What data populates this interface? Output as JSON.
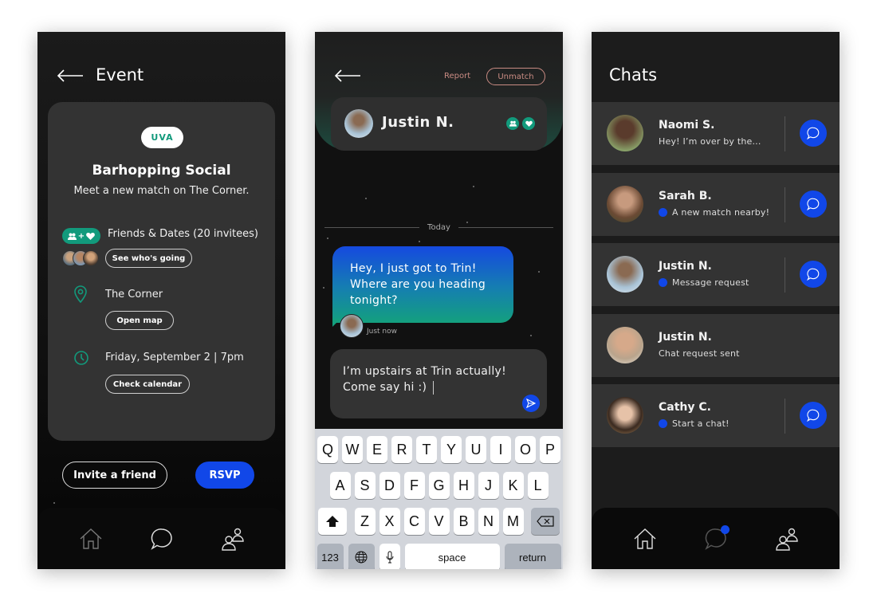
{
  "colors": {
    "accent_blue": "#1147e8",
    "accent_green": "#129a7c",
    "report_red": "#c98b83",
    "card_gray": "#333333",
    "screen_bg": "#1c1c1c"
  },
  "event_screen": {
    "header": {
      "back_icon": "arrow-left-icon",
      "title": "Event"
    },
    "card": {
      "school_tag": "UVA",
      "event_name": "Barhopping Social",
      "event_subtitle": "Meet a new match on The Corner.",
      "audience": {
        "badge_icons": [
          "group-icon",
          "plus",
          "heart-icon"
        ],
        "badge_plus": "+",
        "label": "Friends & Dates (20 invitees)",
        "avatar_count": 3,
        "button": "See who's going"
      },
      "location": {
        "icon": "map-pin-icon",
        "label": "The Corner",
        "button": "Open map"
      },
      "time": {
        "icon": "clock-icon",
        "label": "Friday, September 2 | 7pm",
        "button": "Check calendar"
      }
    },
    "actions": {
      "invite": "Invite a friend",
      "rsvp": "RSVP"
    },
    "tabbar": [
      {
        "icon": "home-icon",
        "label": "Home"
      },
      {
        "icon": "chat-icon",
        "label": "Chats"
      },
      {
        "icon": "people-icon",
        "label": "People"
      }
    ]
  },
  "chat_screen": {
    "header": {
      "back_icon": "arrow-left-icon",
      "report": "Report",
      "unmatch": "Unmatch",
      "contact_name": "Justin N.",
      "contact_badges": [
        "group-icon",
        "heart-icon"
      ]
    },
    "divider_label": "Today",
    "messages": [
      {
        "direction": "incoming",
        "text": "Hey, I just got to Trin! Where are you heading tonight?",
        "time": "Just now"
      }
    ],
    "composer": {
      "text": "I’m upstairs at Trin actually! Come say hi :)",
      "send_icon": "send-icon"
    },
    "keyboard": {
      "rows": [
        [
          "Q",
          "W",
          "E",
          "R",
          "T",
          "Y",
          "U",
          "I",
          "O",
          "P"
        ],
        [
          "A",
          "S",
          "D",
          "F",
          "G",
          "H",
          "J",
          "K",
          "L"
        ],
        [
          "Z",
          "X",
          "C",
          "V",
          "B",
          "N",
          "M"
        ]
      ],
      "shift_icon": "shift-icon",
      "backspace_icon": "backspace-icon",
      "numbers": "123",
      "globe_icon": "globe-icon",
      "mic_icon": "microphone-icon",
      "space": "space",
      "return": "return"
    }
  },
  "chats_screen": {
    "title": "Chats",
    "rows": [
      {
        "name": "Naomi S.",
        "preview": "Hey! I’m over by the...",
        "unread_dot": false,
        "has_chat_button": true
      },
      {
        "name": "Sarah B.",
        "preview": "A new match nearby!",
        "unread_dot": true,
        "has_chat_button": true
      },
      {
        "name": "Justin N.",
        "preview": "Message request",
        "unread_dot": true,
        "has_chat_button": true
      },
      {
        "name": "Justin N.",
        "preview": "Chat request sent",
        "unread_dot": false,
        "has_chat_button": false
      },
      {
        "name": "Cathy C.",
        "preview": "Start a chat!",
        "unread_dot": true,
        "has_chat_button": true
      }
    ],
    "tabbar": [
      {
        "icon": "home-icon",
        "label": "Home"
      },
      {
        "icon": "chat-icon",
        "label": "Chats",
        "notification": true
      },
      {
        "icon": "people-icon",
        "label": "People"
      }
    ]
  }
}
